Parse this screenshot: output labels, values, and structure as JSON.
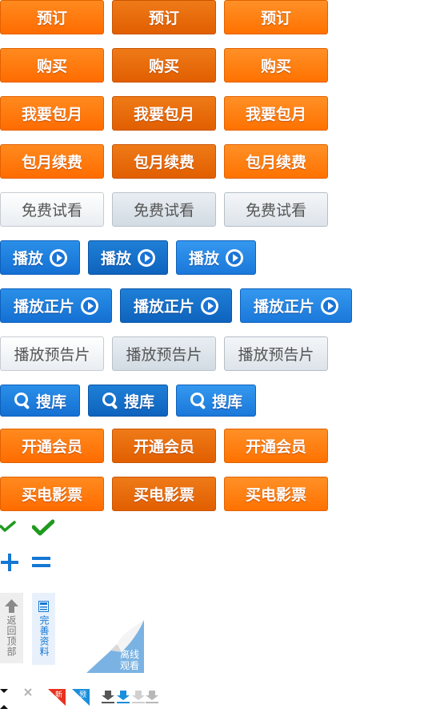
{
  "buttons": {
    "order": "预订",
    "buy": "购买",
    "monthly": "我要包月",
    "renew": "包月续费",
    "free_trial": "免费试看",
    "play": "播放",
    "play_full": "播放正片",
    "play_trailer": "播放预告片",
    "search": "搜库",
    "open_member": "开通会员",
    "buy_movie": "买电影票"
  },
  "side_widgets": {
    "back_to_top": "返回顶部",
    "complete_profile": "完善资料",
    "offline_watch": "离线观看"
  },
  "badges": {
    "new": "新",
    "preview": "预"
  },
  "colors": {
    "orange": "#ff6c00",
    "blue": "#1470d3",
    "gray": "#e9edf1",
    "green": "#1f9a1f"
  }
}
